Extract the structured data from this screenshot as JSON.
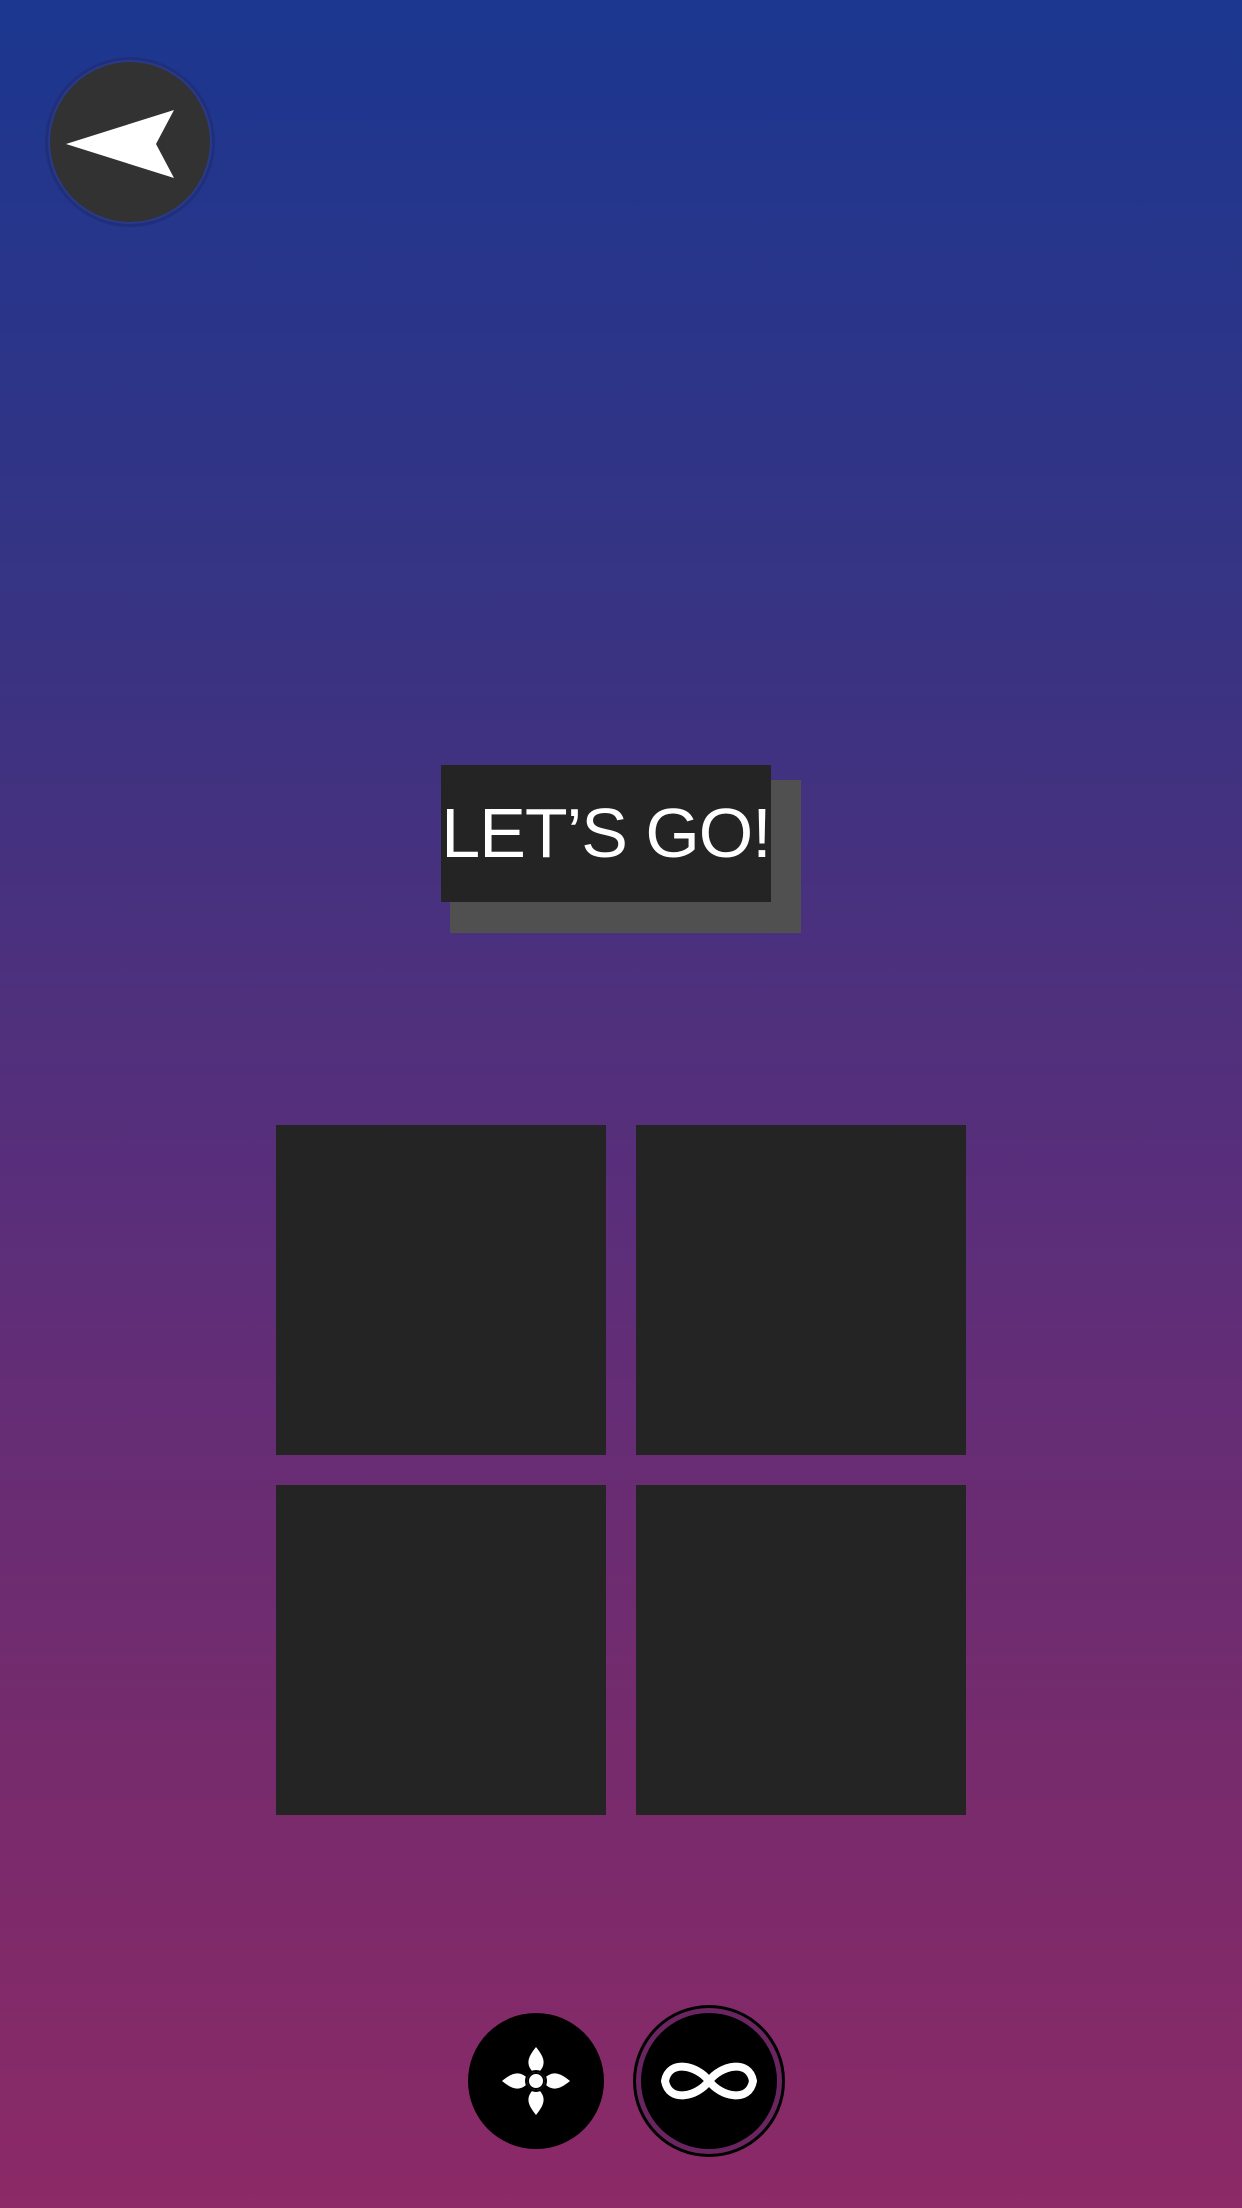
{
  "header": {
    "back_icon": "back-arrow-icon"
  },
  "main": {
    "play_label": "LET’S GO!",
    "tiles": [
      "",
      "",
      "",
      ""
    ]
  },
  "footer": {
    "modes": [
      {
        "icon": "flower-icon",
        "selected": false
      },
      {
        "icon": "infinity-icon",
        "selected": true
      }
    ]
  },
  "colors": {
    "gradient_top": "#1b3790",
    "gradient_bottom": "#8c2967",
    "tile": "#242424",
    "button_shadow": "#505050"
  }
}
